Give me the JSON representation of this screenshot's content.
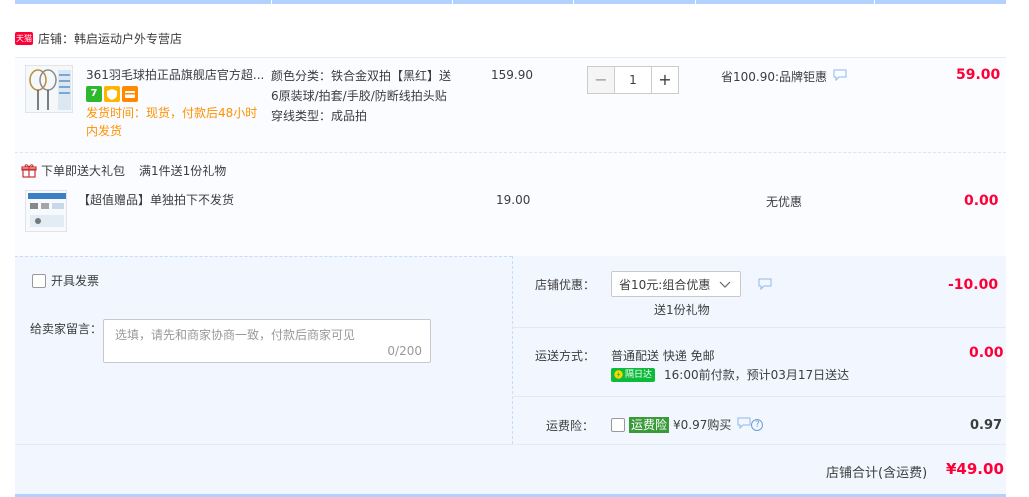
{
  "shop": {
    "tmall_badge": "天猫",
    "name": "店铺：韩启运动户外专营店"
  },
  "main_item": {
    "title": "361羽毛球拍正品旗舰店官方超...",
    "badge_7": "7",
    "ship_time": "发货时间：现货，付款后48小时内发货",
    "sku_line1": "颜色分类：铁合金双拍【黑红】送",
    "sku_line2": "6原装球/拍套/手胶/防断线拍头贴",
    "sku_line3": "穿线类型：成品拍",
    "unit_price": "159.90",
    "quantity": "1",
    "minus": "−",
    "plus": "+",
    "discount": "省100.90:品牌钜惠",
    "subtotal": "59.00"
  },
  "gift_section": {
    "title": "下单即送大礼包",
    "rule": "满1件送1份礼物"
  },
  "gift_item": {
    "title": "【超值赠品】单独拍下不发货",
    "unit_price": "19.00",
    "discount": "无优惠",
    "subtotal": "0.00"
  },
  "invoice": {
    "label": "开具发票"
  },
  "message": {
    "label": "给卖家留言：",
    "placeholder": "选填，请先和商家协商一致，付款后商家可见",
    "counter": "0/200"
  },
  "shop_discount": {
    "label": "店铺优惠：",
    "selected": "省10元:组合优惠",
    "gift_note": "送1份礼物",
    "amount": "-10.00"
  },
  "shipping": {
    "label": "运送方式：",
    "method": "普通配送 快递 免邮",
    "next_day_badge": "隔日达",
    "eta": "16:00前付款，预计03月17日送达",
    "amount": "0.00"
  },
  "insurance": {
    "label": "运费险：",
    "badge": "运费险",
    "price": "¥0.97购买",
    "amount": "0.97"
  },
  "total": {
    "label": "店铺合计(含运费)",
    "amount": "¥49.00"
  },
  "colors": {
    "accent_red": "#ff0036",
    "light_blue": "#f2f7ff",
    "orange": "#ff9100"
  }
}
